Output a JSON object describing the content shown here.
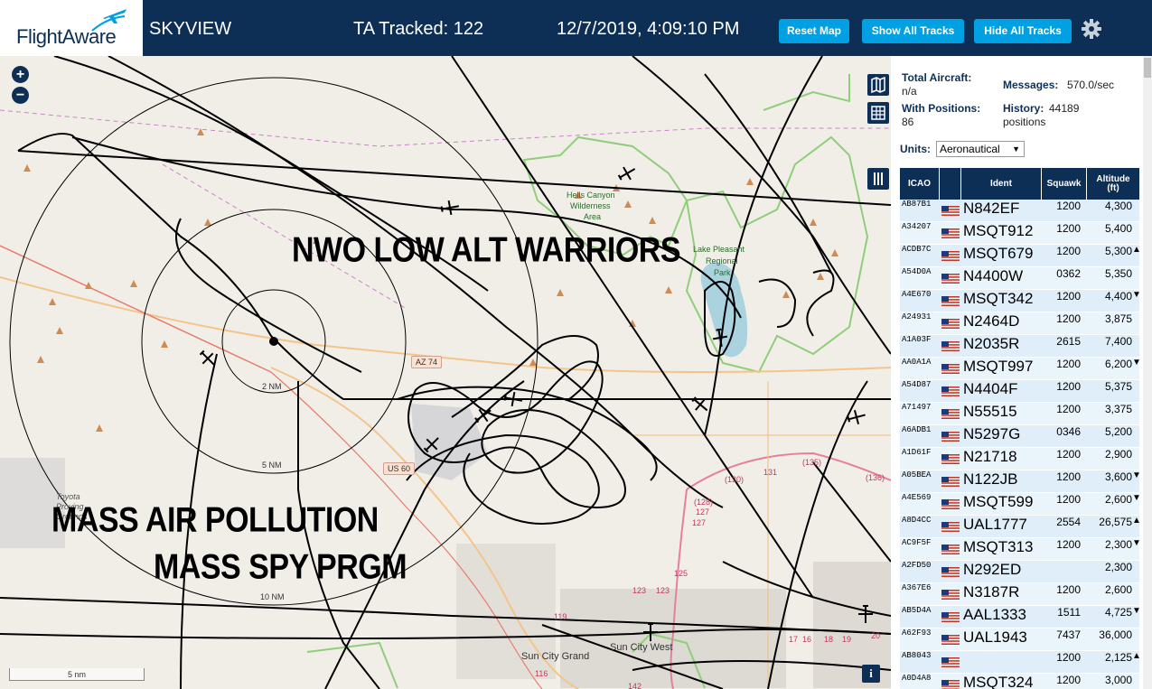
{
  "header": {
    "logo_text": "FlightAware",
    "app_title": "SKYVIEW",
    "ta_tracked": "TA Tracked: 122",
    "clock": "12/7/2019, 4:09:10 PM",
    "buttons": {
      "reset": "Reset Map",
      "show_all": "Show All Tracks",
      "hide_all": "Hide All Tracks"
    }
  },
  "map": {
    "overlay_texts": [
      "NWO LOW ALT WARRIORS",
      "MASS AIR POLLUTION",
      "MASS SPY PRGM"
    ],
    "range_labels": [
      "2 NM",
      "5 NM",
      "10 NM"
    ],
    "places": [
      "Hells Canyon",
      "Wilderness",
      "Area",
      "Lake Pleasant",
      "Regional",
      "Park",
      "Sun City Grand",
      "Sun City West",
      "Toyota",
      "Proving",
      "Grounds"
    ],
    "road_shields": [
      "AZ 74",
      "US 60"
    ],
    "route_numbers": [
      "(130)",
      "131",
      "(135)",
      "(136)",
      "(128)",
      "127",
      "127",
      "125",
      "123",
      "123",
      "119",
      "116",
      "142",
      "17",
      "16",
      "18",
      "19",
      "20"
    ],
    "zoom_in": "+",
    "zoom_out": "−",
    "scale_label": "5 nm",
    "info": "i"
  },
  "stats": {
    "total_aircraft_label": "Total Aircraft:",
    "total_aircraft_value": "n/a",
    "with_positions_label": "With Positions:",
    "with_positions_value": "86",
    "messages_label": "Messages:",
    "messages_value": "570.0/sec",
    "history_label": "History:",
    "history_value": "44189",
    "history_unit": "positions",
    "units_label": "Units:",
    "units_value": "Aeronautical"
  },
  "table": {
    "headers": {
      "icao": "ICAO",
      "ident": "Ident",
      "squawk": "Squawk",
      "altitude": "Altitude",
      "altitude_unit": "(ft)"
    },
    "rows": [
      {
        "icao": "AB87B1",
        "ident": "N842EF",
        "squawk": "1200",
        "altitude": "4,300",
        "trend": ""
      },
      {
        "icao": "A34207",
        "ident": "MSQT912",
        "squawk": "1200",
        "altitude": "5,400",
        "trend": ""
      },
      {
        "icao": "ACDB7C",
        "ident": "MSQT679",
        "squawk": "1200",
        "altitude": "5,300",
        "trend": "▲"
      },
      {
        "icao": "A54D0A",
        "ident": "N4400W",
        "squawk": "0362",
        "altitude": "5,350",
        "trend": ""
      },
      {
        "icao": "A4E670",
        "ident": "MSQT342",
        "squawk": "1200",
        "altitude": "4,400",
        "trend": "▼"
      },
      {
        "icao": "A24931",
        "ident": "N2464D",
        "squawk": "1200",
        "altitude": "3,875",
        "trend": ""
      },
      {
        "icao": "A1A03F",
        "ident": "N2035R",
        "squawk": "2615",
        "altitude": "7,400",
        "trend": ""
      },
      {
        "icao": "AA0A1A",
        "ident": "MSQT997",
        "squawk": "1200",
        "altitude": "6,200",
        "trend": "▼"
      },
      {
        "icao": "A54D87",
        "ident": "N4404F",
        "squawk": "1200",
        "altitude": "5,375",
        "trend": ""
      },
      {
        "icao": "A71497",
        "ident": "N55515",
        "squawk": "1200",
        "altitude": "3,375",
        "trend": ""
      },
      {
        "icao": "A6ADB1",
        "ident": "N5297G",
        "squawk": "0346",
        "altitude": "5,200",
        "trend": ""
      },
      {
        "icao": "A1D61F",
        "ident": "N21718",
        "squawk": "1200",
        "altitude": "2,900",
        "trend": ""
      },
      {
        "icao": "A05BEA",
        "ident": "N122JB",
        "squawk": "1200",
        "altitude": "3,600",
        "trend": "▼"
      },
      {
        "icao": "A4E569",
        "ident": "MSQT599",
        "squawk": "1200",
        "altitude": "2,600",
        "trend": "▼"
      },
      {
        "icao": "A8D4CC",
        "ident": "UAL1777",
        "squawk": "2554",
        "altitude": "26,575",
        "trend": "▲"
      },
      {
        "icao": "AC9F5F",
        "ident": "MSQT313",
        "squawk": "1200",
        "altitude": "2,300",
        "trend": "▼"
      },
      {
        "icao": "A2FD50",
        "ident": "N292ED",
        "squawk": "",
        "altitude": "2,300",
        "trend": ""
      },
      {
        "icao": "A367E6",
        "ident": "N3187R",
        "squawk": "1200",
        "altitude": "2,600",
        "trend": ""
      },
      {
        "icao": "AB5D4A",
        "ident": "AAL1333",
        "squawk": "1511",
        "altitude": "4,725",
        "trend": "▼"
      },
      {
        "icao": "A62F93",
        "ident": "UAL1943",
        "squawk": "7437",
        "altitude": "36,000",
        "trend": ""
      },
      {
        "icao": "AB8043",
        "ident": "",
        "squawk": "1200",
        "altitude": "2,125",
        "trend": "▲"
      },
      {
        "icao": "A0D4A8",
        "ident": "MSQT324",
        "squawk": "1200",
        "altitude": "3,000",
        "trend": ""
      }
    ]
  },
  "colors": {
    "header_bg": "#0e2f55",
    "button_bg": "#00a0e2",
    "row_bg": "#dfeef8",
    "map_bg": "#f1eee8",
    "lake": "#aad3df",
    "park_border": "#8fce7a"
  }
}
